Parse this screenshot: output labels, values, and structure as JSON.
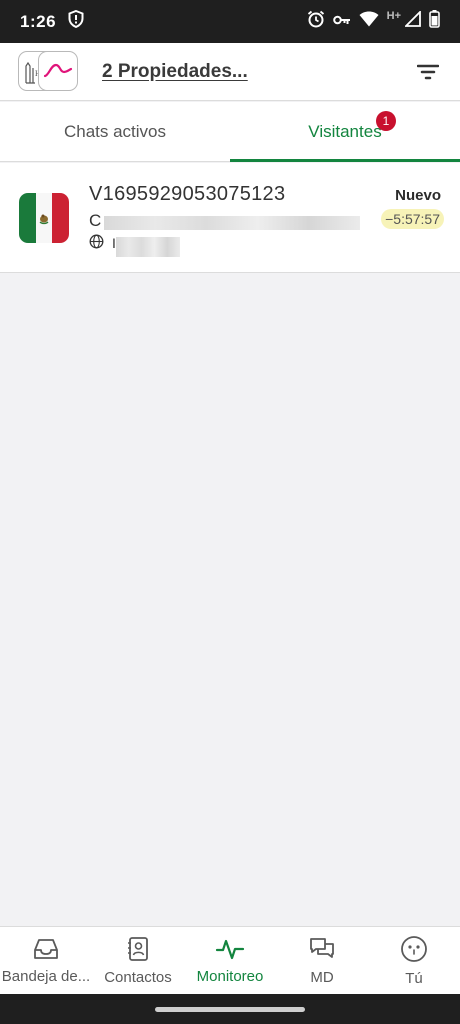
{
  "statusbar": {
    "time": "1:26",
    "network_label": "H+"
  },
  "header": {
    "title": "2 Propiedades...",
    "logo_text": "H"
  },
  "tabs": [
    {
      "label": "Chats activos",
      "active": false
    },
    {
      "label": "Visitantes",
      "active": true,
      "badge": "1"
    }
  ],
  "visitor": {
    "id": "V1695929053075123",
    "status": "Nuevo",
    "line2_prefix": "C",
    "elapsed": "−5:57:57",
    "line3_prefix": "I",
    "country_flag": "mexico"
  },
  "nav": [
    {
      "label": "Bandeja de...",
      "icon": "inbox-icon",
      "active": false
    },
    {
      "label": "Contactos",
      "icon": "contacts-icon",
      "active": false
    },
    {
      "label": "Monitoreo",
      "icon": "pulse-icon",
      "active": true
    },
    {
      "label": "MD",
      "icon": "messages-icon",
      "active": false
    },
    {
      "label": "Tú",
      "icon": "profile-icon",
      "active": false
    }
  ],
  "colors": {
    "accent": "#13853f",
    "badge": "#c8102e",
    "highlight": "#f7f3b8"
  }
}
